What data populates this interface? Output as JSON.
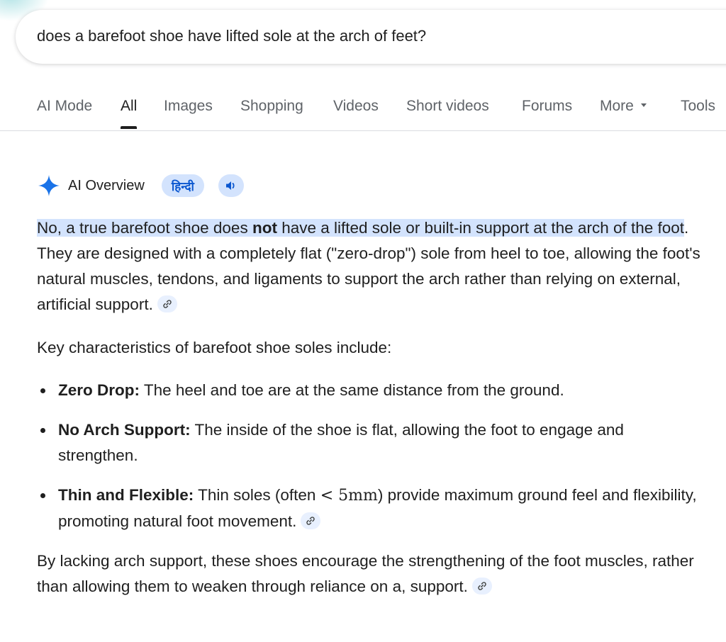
{
  "search": {
    "query": "does a barefoot shoe have lifted sole at the arch of feet?"
  },
  "tabs": [
    {
      "label": "AI Mode",
      "active": false
    },
    {
      "label": "All",
      "active": true
    },
    {
      "label": "Images",
      "active": false
    },
    {
      "label": "Shopping",
      "active": false
    },
    {
      "label": "Videos",
      "active": false
    },
    {
      "label": "Short videos",
      "active": false
    },
    {
      "label": "Forums",
      "active": false
    },
    {
      "label": "More",
      "active": false
    },
    {
      "label": "Tools",
      "active": false
    }
  ],
  "overview": {
    "title": "AI Overview",
    "language_chip": "हिन्दी",
    "listen_icon": "speaker-icon",
    "intro": {
      "highlight_part1": "No, a true barefoot shoe does ",
      "highlight_bold": "not",
      "highlight_part2": " have a lifted sole or built-in support at the arch of the foot",
      "rest": ". They are designed with a completely flat (\"zero-drop\") sole from heel to toe, allowing the foot's natural muscles, tendons, and ligaments to support the arch rather than relying on external, artificial support."
    },
    "key_heading": "Key characteristics of barefoot shoe soles include:",
    "bullets": [
      {
        "term": "Zero Drop:",
        "text": " The heel and toe are at the same distance from the ground."
      },
      {
        "term": "No Arch Support:",
        "text": " The inside of the shoe is flat, allowing the foot to engage and strengthen."
      },
      {
        "term": "Thin and Flexible:",
        "text_before": " Thin soles (often ",
        "math": "< 5mm",
        "text_after": ") provide maximum ground feel and flexibility, promoting natural foot movement."
      }
    ],
    "conclusion": "By lacking arch support, these shoes encourage the strengthening of the foot muscles, rather than allowing them to weaken through reliance on a, support."
  },
  "colors": {
    "highlight": "#d3e3fd",
    "chip_text": "#0b57d0",
    "link_chip": "#e8f0fe",
    "sparkle": "#1a73e8"
  }
}
